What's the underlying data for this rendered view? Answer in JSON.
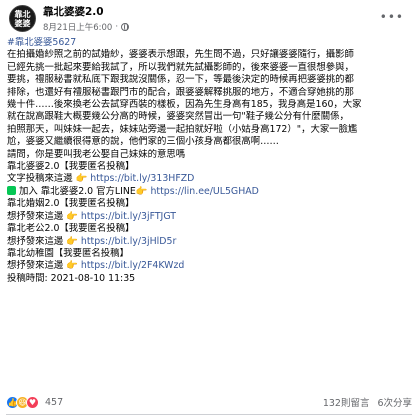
{
  "page": {
    "avatar_text_top": "靠北",
    "avatar_text_bottom": "婆婆",
    "name": "靠北婆婆2.0",
    "timestamp": "8月21日上午6:00",
    "dot": "·"
  },
  "post": {
    "hashtag": "#靠北婆婆5627",
    "lines": [
      "在拍攝婚紗照之前的試婚紗，婆婆表示想跟，先生問不過，只好讓婆婆隨行，攝影師",
      "已經先挑一批起來要給我試了，所以我們就先試攝影師的，後來婆婆一直很想參與，",
      "要挑，禮服秘書就私底下跟我說沒關係，忍一下，等最後決定的時候再把婆婆挑的都",
      "排除，也還好有禮服秘書跟門市的配合，跟婆婆解釋挑服的地方，不適合穿她挑的那",
      "幾十件……後來換老公去試穿西裝的樣板，因為先生身高有185，我身高是160，大家",
      "就在說高跟鞋大概要幾公分高的時候，婆婆突然冒出一句\"鞋子幾公分有什麼關係，",
      "拍照那天，叫妹妹一起去，妹妹站旁邊一起拍就好啦（小姑身高172）\"，大家一臉尷",
      "尬，婆婆又繼續很得意的說，他們家的三個小孩身高都很高啊……"
    ],
    "question": "請問，你是要叫我老公娶自己妹妹的意思嗎"
  },
  "promos": {
    "p1_title": "靠北婆婆2.0【我要匿名投稿】",
    "p1_text_label": "文字投稿來這邊 ",
    "p1_text_link": "https://bit.ly/313HFZD",
    "p1_line_label": "加入 靠北婆婆2.0 官方LINE",
    "p1_line_link": "https://lin.ee/UL5GHAD",
    "p2_title": "靠北婚姻2.0【我要匿名投稿】",
    "p2_label": "想抒發來這邊 ",
    "p2_link": "https://bit.ly/3jFTJGT",
    "p3_title": "靠北老公2.0【我要匿名投稿】",
    "p3_label": "想抒發來這邊 ",
    "p3_link": "https://bit.ly/3jHlD5r",
    "p4_title": "靠北幼稚園【我要匿名投稿】",
    "p4_label": "想抒發來這邊 ",
    "p4_link": "https://bit.ly/2F4KWzd",
    "posted_time": "投稿時間: 2021-08-10 11:35"
  },
  "footer": {
    "reaction_count": "457",
    "comments": "132則留言",
    "shares": "6次分享"
  },
  "colors": {
    "link": "#385898",
    "like": "#1877f2",
    "haha": "#f7b125",
    "love": "#f33e58"
  }
}
